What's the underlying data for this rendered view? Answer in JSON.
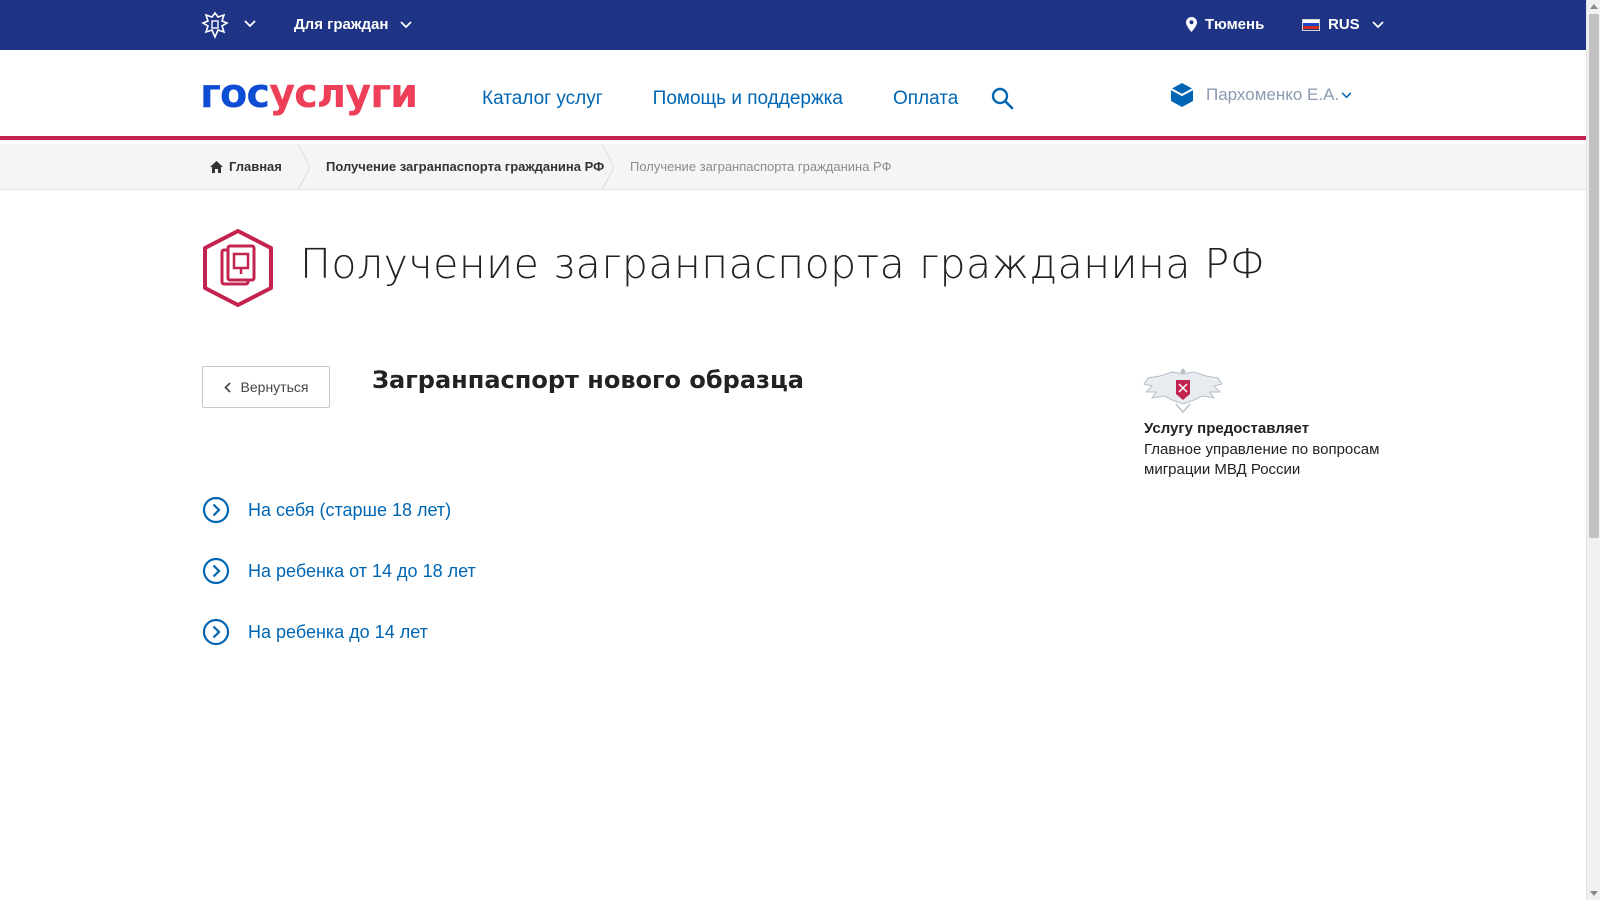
{
  "topbar": {
    "audience": "Для граждан",
    "city": "Тюмень",
    "language": "RUS",
    "bg_color": "#1f3484"
  },
  "header": {
    "logo_part1": "гос",
    "logo_part2": "услуги",
    "nav": [
      "Каталог услуг",
      "Помощь и поддержка",
      "Оплата"
    ],
    "user_name": "Пархоменко Е.А.",
    "accent_color": "#c2244f",
    "link_color": "#0066b3"
  },
  "breadcrumb": {
    "home": "Главная",
    "level2": "Получение загранпаспорта гражданина РФ",
    "current": "Получение загранпаспорта гражданина РФ"
  },
  "page": {
    "title": "Получение загранпаспорта гражданина РФ",
    "back_label": "Вернуться",
    "subtitle": "Загранпаспорт нового образца",
    "options": [
      "На себя (старше 18 лет)",
      "На ребенка от 14 до 18 лет",
      "На ребенка до 14 лет"
    ]
  },
  "provider": {
    "label": "Услугу предоставляет",
    "name": "Главное управление по вопросам миграции МВД России"
  },
  "icons": {
    "emblem": "russian-emblem-icon",
    "location": "location-pin-icon",
    "flag": "russian-flag-icon",
    "search": "search-icon",
    "user": "user-badge-icon",
    "home": "home-icon",
    "service": "passport-icon",
    "option": "circle-chevron-right-icon"
  }
}
